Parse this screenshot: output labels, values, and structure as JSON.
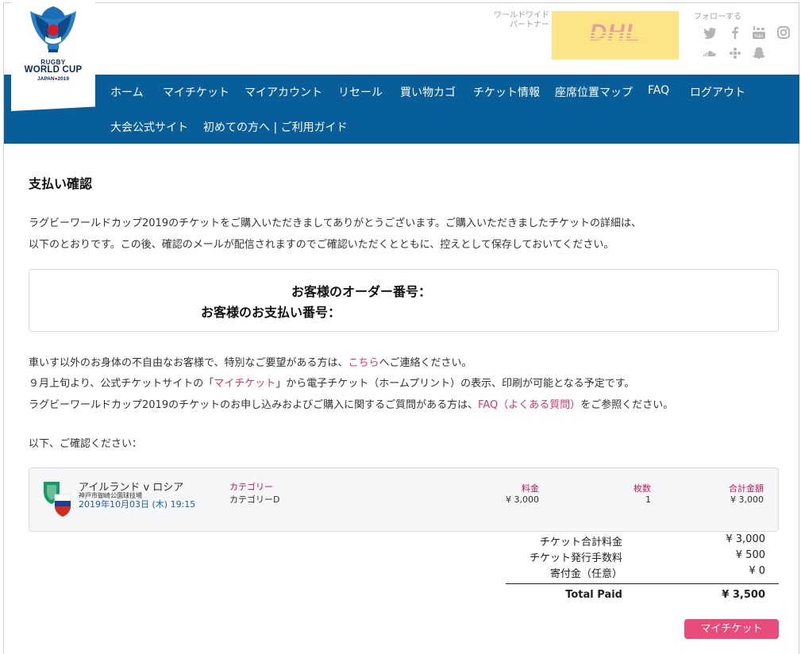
{
  "logo": {
    "line1": "RUGBY",
    "line2": "WORLD CUP",
    "line3_a": "JAPAN",
    "line3_b": "2019"
  },
  "partner": {
    "label": "ワールドワイド パートナー",
    "brand": "DHL"
  },
  "follow_label": "フォローする",
  "social_icons": [
    "twitter-icon",
    "facebook-icon",
    "youtube-icon",
    "instagram-icon",
    "soundcloud-icon",
    "weibo-icon",
    "snapchat-icon"
  ],
  "nav": {
    "row1": [
      "ホーム",
      "マイチケット",
      "マイアカウント",
      "リセール",
      "買い物カゴ",
      "チケット情報",
      "座席位置マップ",
      "FAQ",
      "ログアウト"
    ],
    "row2": [
      "大会公式サイト",
      "初めての方へ | ご利用ガイド"
    ]
  },
  "page_title": "支払い確認",
  "intro": {
    "line1": "ラグビーワールドカップ2019のチケットをご購入いただきましてありがとうございます。ご購入いただきましたチケットの詳細は、",
    "line2": "以下のとおりです。この後、確認のメールが配信されますのでご確認いただくとともに、控えとして保存しておいてください。"
  },
  "order": {
    "order_label": "お客様のオーダー番号：",
    "payment_label": "お客様のお支払い番号："
  },
  "notes": {
    "l1_pre": "車いす以外のお身体の不自由なお客様で、特別なご要望がある方は、",
    "l1_link": "こちら",
    "l1_post": "へご連絡ください。",
    "l2_pre": "９月上旬より、公式チケットサイトの「",
    "l2_link": "マイチケット",
    "l2_post": "」から電子チケット（ホームプリント）の表示、印刷が可能となる予定です。",
    "l3_pre": "ラグビーワールドカップ2019のチケットのお申し込みおよびご購入に関するご質問がある方は、",
    "l3_link": "FAQ（よくある質問）",
    "l3_post": "をご参照ください。"
  },
  "confirm_label": "以下、ご確認ください：",
  "ticket": {
    "match": "アイルランド v ロシア",
    "venue": "神戸市御崎公園球技場",
    "datetime": "2019年10月03日 (木) 19:15",
    "category_label": "カテゴリー",
    "category_value": "カテゴリーD",
    "price_label": "料金",
    "price_value": "¥ 3,000",
    "qty_label": "枚数",
    "qty_value": "1",
    "total_label": "合計金額",
    "total_value": "¥ 3,000"
  },
  "summary": {
    "ticket_total_label": "チケット合計料金",
    "ticket_total_value": "¥ 3,000",
    "fee_label": "チケット発行手数料",
    "fee_value": "¥ 500",
    "donation_label": "寄付金（任意）",
    "donation_value": "¥ 0",
    "paid_label": "Total Paid",
    "paid_value": "¥ 3,500"
  },
  "button_label": "マイチケット",
  "colors": {
    "nav_bg": "#075e99",
    "accent_pink": "#e94b7b",
    "link": "#d2396a",
    "dhl_yellow": "#fde486"
  }
}
